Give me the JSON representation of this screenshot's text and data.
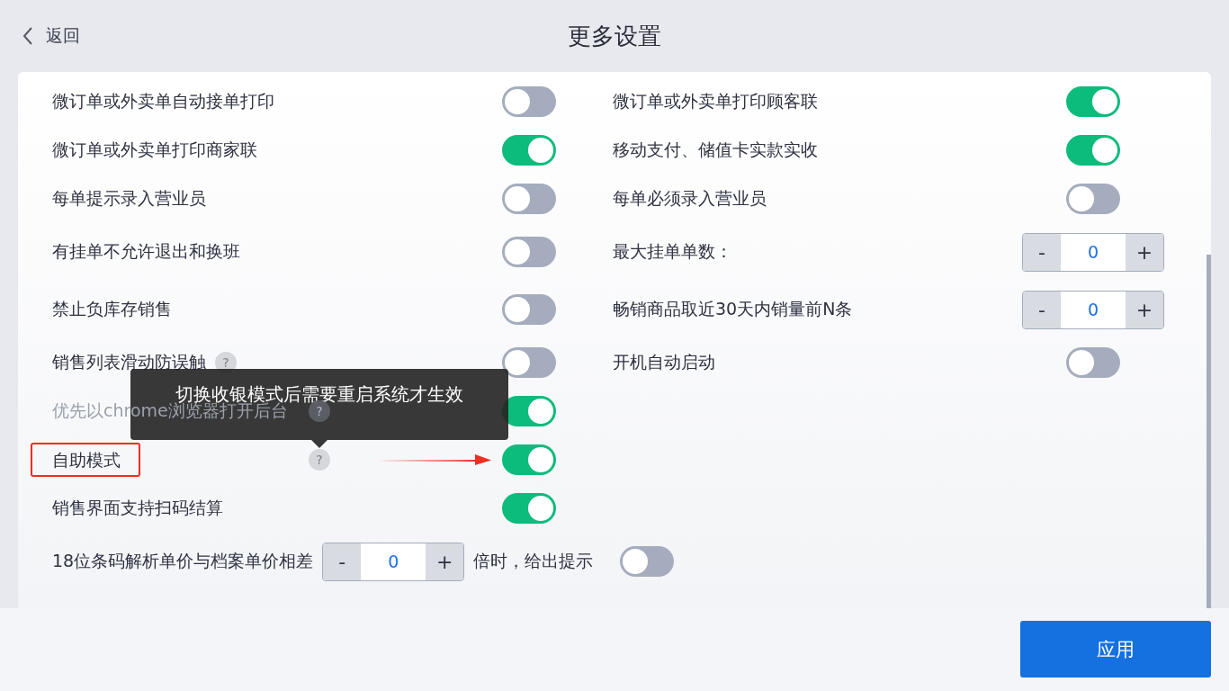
{
  "header": {
    "back_label": "返回",
    "title": "更多设置"
  },
  "rows": [
    {
      "left": {
        "label": "微订单或外卖单自动接单打印",
        "kind": "toggle",
        "on": false
      },
      "right": {
        "label": "微订单或外卖单打印顾客联",
        "kind": "toggle",
        "on": true
      }
    },
    {
      "left": {
        "label": "微订单或外卖单打印商家联",
        "kind": "toggle",
        "on": true
      },
      "right": {
        "label": "移动支付、储值卡实款实收",
        "kind": "toggle",
        "on": true
      }
    },
    {
      "left": {
        "label": "每单提示录入营业员",
        "kind": "toggle",
        "on": false
      },
      "right": {
        "label": "每单必须录入营业员",
        "kind": "toggle",
        "on": false
      }
    },
    {
      "left": {
        "label": "有挂单不允许退出和换班",
        "kind": "toggle",
        "on": false
      },
      "right": {
        "label": "最大挂单单数：",
        "kind": "stepper",
        "minus": "-",
        "value": "0",
        "plus": "+"
      }
    },
    {
      "left": {
        "label": "禁止负库存销售",
        "kind": "toggle",
        "on": false
      },
      "right": {
        "label": "畅销商品取近30天内销量前N条",
        "kind": "stepper",
        "minus": "-",
        "value": "0",
        "plus": "+"
      }
    },
    {
      "left": {
        "label": "销售列表滑动防误触",
        "kind": "toggle",
        "on": false,
        "help": {
          "aligned": false,
          "glyph": "?"
        }
      },
      "right": {
        "label": "开机自动启动",
        "kind": "toggle",
        "on": false
      }
    },
    {
      "left": {
        "label": "优先以chrome浏览器打开后台",
        "kind": "toggle",
        "on": true,
        "overlaid": true,
        "help": {
          "aligned": true,
          "glyph": "?"
        }
      }
    },
    {
      "left": {
        "label": "自助模式",
        "kind": "toggle",
        "on": true,
        "highlighted": true,
        "arrow": true,
        "help": {
          "aligned": true,
          "glyph": "?",
          "tooltip": "切换收银模式后需要重启系统才生效"
        }
      }
    },
    {
      "left": {
        "label": "销售界面支持扫码结算",
        "kind": "toggle",
        "on": true
      }
    }
  ],
  "threshold_row": {
    "label": "18位条码解析单价与档案单价相差",
    "stepper": {
      "minus": "-",
      "value": "0",
      "plus": "+"
    },
    "suffix": "倍时，给出提示",
    "on": false
  },
  "footer": {
    "apply_label": "应用"
  }
}
